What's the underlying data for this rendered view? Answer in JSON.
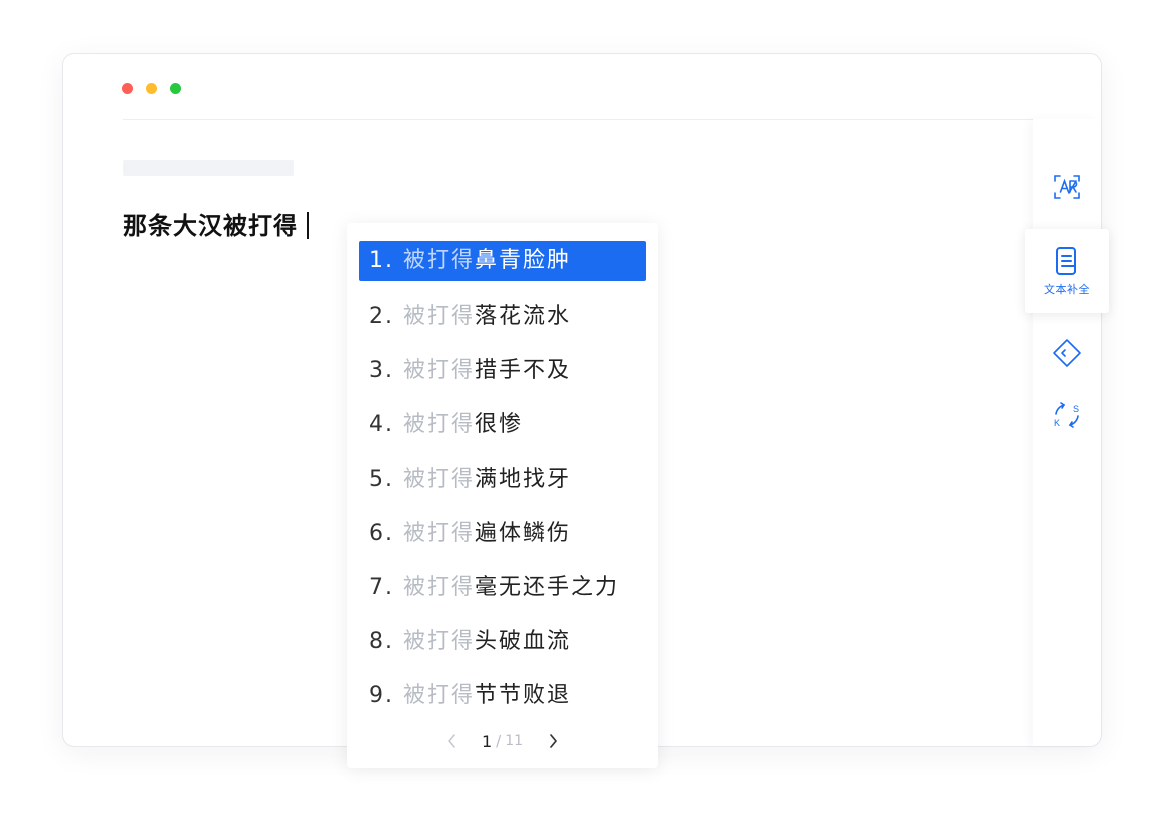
{
  "colors": {
    "accent": "#1c6cf2",
    "traffic_red": "#fd5f57",
    "traffic_yellow": "#febc2e",
    "traffic_green": "#28c840"
  },
  "editor": {
    "text": "那条大汉被打得"
  },
  "sidebar": {
    "tools": [
      {
        "icon": "ocr-scan-icon",
        "label": ""
      },
      {
        "icon": "document-complete-icon",
        "label": "文本补全",
        "active": true
      },
      {
        "icon": "tag-icon",
        "label": ""
      },
      {
        "icon": "sync-icon",
        "label": ""
      }
    ]
  },
  "suggestions": {
    "prefix": "被打得",
    "items": [
      {
        "num": "1.",
        "completion": "鼻青脸肿",
        "selected": true
      },
      {
        "num": "2.",
        "completion": "落花流水"
      },
      {
        "num": "3.",
        "completion": "措手不及"
      },
      {
        "num": "4.",
        "completion": "很惨"
      },
      {
        "num": "5.",
        "completion": "满地找牙"
      },
      {
        "num": "6.",
        "completion": "遍体鳞伤"
      },
      {
        "num": "7.",
        "completion": "毫无还手之力"
      },
      {
        "num": "8.",
        "completion": "头破血流"
      },
      {
        "num": "9.",
        "completion": "节节败退"
      }
    ],
    "pager": {
      "current": "1",
      "separator": "/",
      "total": "11"
    }
  }
}
